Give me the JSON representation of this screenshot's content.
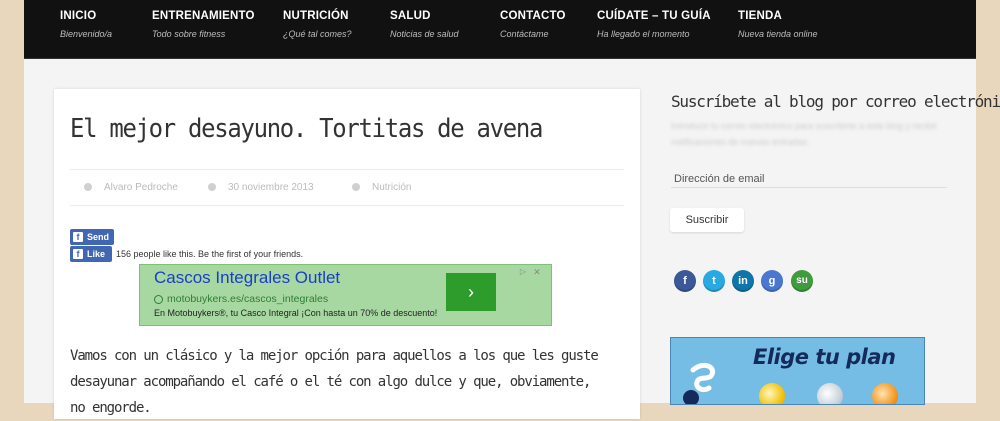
{
  "nav": {
    "items": [
      {
        "title": "INICIO",
        "subtitle": "Bienvenido/a"
      },
      {
        "title": "ENTRENAMIENTO",
        "subtitle": "Todo sobre fitness"
      },
      {
        "title": "NUTRICIÓN",
        "subtitle": "¿Qué tal comes?"
      },
      {
        "title": "SALUD",
        "subtitle": "Noticias de salud"
      },
      {
        "title": "CONTACTO",
        "subtitle": "Contáctame"
      },
      {
        "title": "CUÍDATE – TU GUÍA",
        "subtitle": "Ha llegado el momento"
      },
      {
        "title": "TIENDA",
        "subtitle": "Nueva tienda online"
      }
    ]
  },
  "post": {
    "title": "El mejor desayuno. Tortitas de avena",
    "author": "Alvaro Pedroche",
    "date": "30 noviembre 2013",
    "category": "Nutrición",
    "intro": "Vamos con un clásico y la mejor opción para aquellos a los que les guste desayunar acompañando el café o el té con algo dulce y que, obviamente, no engorde."
  },
  "facebook": {
    "send_label": "Send",
    "like_label": "Like",
    "like_text": "156 people like this. Be the first of your friends."
  },
  "ad": {
    "title": "Cascos Integrales Outlet",
    "url": "motobuykers.es/cascos_integrales",
    "description": "En Motobuykers®, tu Casco Integral ¡Con hasta un 70% de descuento!",
    "arrow_icon": "chevron-right-icon"
  },
  "sidebar": {
    "title": "Suscríbete al blog por correo electrónico",
    "description": "Introduce tu correo electrónico para suscribirte a este blog y recibir notificaciones de nuevas entradas.",
    "email_placeholder": "Dirección de email",
    "subscribe_label": "Suscribir",
    "social": [
      {
        "name": "facebook-icon",
        "glyph": "f",
        "color": "#3b5998"
      },
      {
        "name": "twitter-icon",
        "glyph": "t",
        "color": "#29a9e1"
      },
      {
        "name": "linkedin-icon",
        "glyph": "in",
        "color": "#0e76a8"
      },
      {
        "name": "google-plus-icon",
        "glyph": "g",
        "color": "#4a78d0"
      },
      {
        "name": "stumbleupon-icon",
        "glyph": "su",
        "color": "#3f9b3d"
      }
    ],
    "banner_title": "Elige tu plan"
  }
}
